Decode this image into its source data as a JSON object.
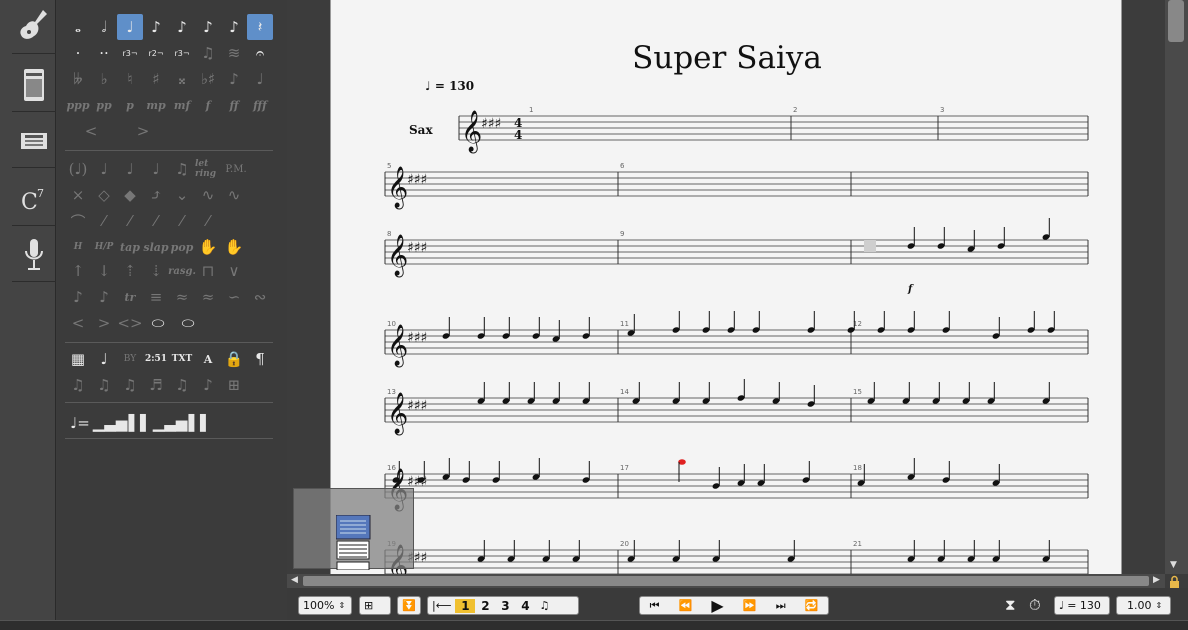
{
  "score": {
    "title": "Super Saiya",
    "tempo_value": "130",
    "tempo_prefix": "= ",
    "instrument": "Sax",
    "dynamic": "f",
    "measure_numbers": [
      "1",
      "2",
      "3",
      "5",
      "6",
      "8",
      "9",
      "10",
      "11",
      "12",
      "13",
      "14",
      "15",
      "16",
      "17",
      "18",
      "19",
      "20",
      "21"
    ]
  },
  "palette": {
    "dynamics": [
      "ppp",
      "pp",
      "p",
      "mp",
      "mf",
      "f",
      "ff",
      "fff"
    ],
    "tuplets": [
      "r3¬",
      "r2¬",
      "r3¬"
    ],
    "effects_text": [
      "let ring",
      "P.M."
    ],
    "techniques": [
      "tap",
      "slap",
      "pop"
    ],
    "rasg": "rasg.",
    "tr": "tr",
    "text_tools": [
      "BY",
      "2:51",
      "TXT",
      "A"
    ]
  },
  "toolbar": {
    "zoom": "100%",
    "voices": [
      "1",
      "2",
      "3",
      "4"
    ],
    "active_voice": "1",
    "tempo": "= 130",
    "speed": "1.00"
  },
  "colors": {
    "selection": "#5f8fc9",
    "active_voice": "#f0c030",
    "highlight_note": "#e02020"
  }
}
